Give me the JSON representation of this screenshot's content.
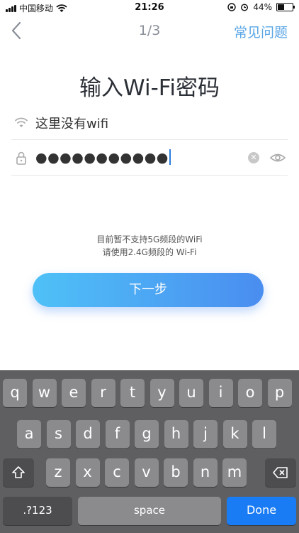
{
  "status_bar": {
    "carrier": "中国移动",
    "time": "21:26",
    "battery": "44%",
    "battery_level": 0.44
  },
  "nav": {
    "step": "1/3",
    "faq": "常见问题"
  },
  "page_title": "输入Wi-Fi密码",
  "wifi_row": {
    "ssid": "这里没有wifi"
  },
  "password_row": {
    "masked_value": "●●●●●●●●●●●"
  },
  "hint": {
    "line1": "目前暂不支持5G频段的WiFi",
    "line2": "请使用2.4G频段的 Wi-Fi"
  },
  "next_button": "下一步",
  "keyboard": {
    "row1": [
      "q",
      "w",
      "e",
      "r",
      "t",
      "y",
      "u",
      "i",
      "o",
      "p"
    ],
    "row2": [
      "a",
      "s",
      "d",
      "f",
      "g",
      "h",
      "j",
      "k",
      "l"
    ],
    "row3": [
      "z",
      "x",
      "c",
      "v",
      "b",
      "n",
      "m"
    ],
    "numbers_key": ".?123",
    "space_key": "space",
    "done_key": "Done"
  }
}
